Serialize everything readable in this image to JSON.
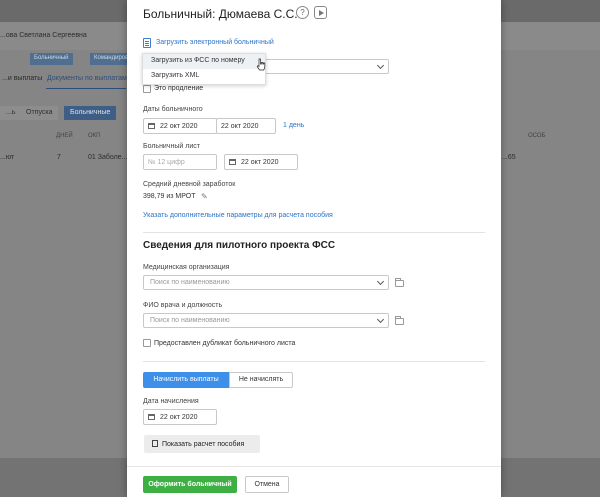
{
  "background": {
    "employee_name": "...ова Светлана Сергеевна",
    "tabs_row1": [
      "Больничный",
      "Командировка"
    ],
    "links_row": [
      "...и выплаты",
      "Документы по выплатам"
    ],
    "tabs_row2": [
      "...ь",
      "Отпуска",
      "Больничные"
    ],
    "columns": [
      "ДНЕЙ",
      "ОКП",
      "ОСОБ"
    ],
    "row": [
      "...ют",
      "7",
      "01 Заболе...",
      "...65"
    ]
  },
  "modal": {
    "title": "Больничный: Дюмаева С.С.",
    "help_glyph": "?",
    "upload_link": "Загрузить электронный больничный",
    "dropdown_items": [
      "Загрузить из ФСС по номеру",
      "Загрузить XML"
    ],
    "extension_label": "Это продление",
    "sick_dates_label": "Даты больничного",
    "date_from": "22 окт 2020",
    "date_to": "22 окт 2020",
    "duration": "1 день",
    "sick_sheet_label": "Больничный лист",
    "sheet_number_placeholder": "№ 12 цифр",
    "sheet_date": "22 окт 2020",
    "avg_earnings_label": "Средний дневной заработок",
    "avg_earnings_value": "398,79 из МРОТ",
    "extra_params_link": "Указать дополнительные параметры для расчета пособия",
    "pilot_section_title": "Сведения для пилотного проекта ФСС",
    "med_org_label": "Медицинская организация",
    "med_org_placeholder": "Поиск по наименованию",
    "doctor_label": "ФИО врача и должность",
    "doctor_placeholder": "Поиск по наименованию",
    "duplicate_label": "Предоставлен дубликат больничного листа",
    "calc_on_label": "Начислить выплаты",
    "calc_off_label": "Не начислять",
    "accrual_date_label": "Дата начисления",
    "accrual_date": "22 окт 2020",
    "show_calc_button": "Показать расчет пособия",
    "submit_button": "Оформить больничный",
    "cancel_button": "Отмена"
  },
  "colors": {
    "accent_blue": "#3d8fea",
    "link_blue": "#2b74c8",
    "submit_green": "#3eb043"
  }
}
